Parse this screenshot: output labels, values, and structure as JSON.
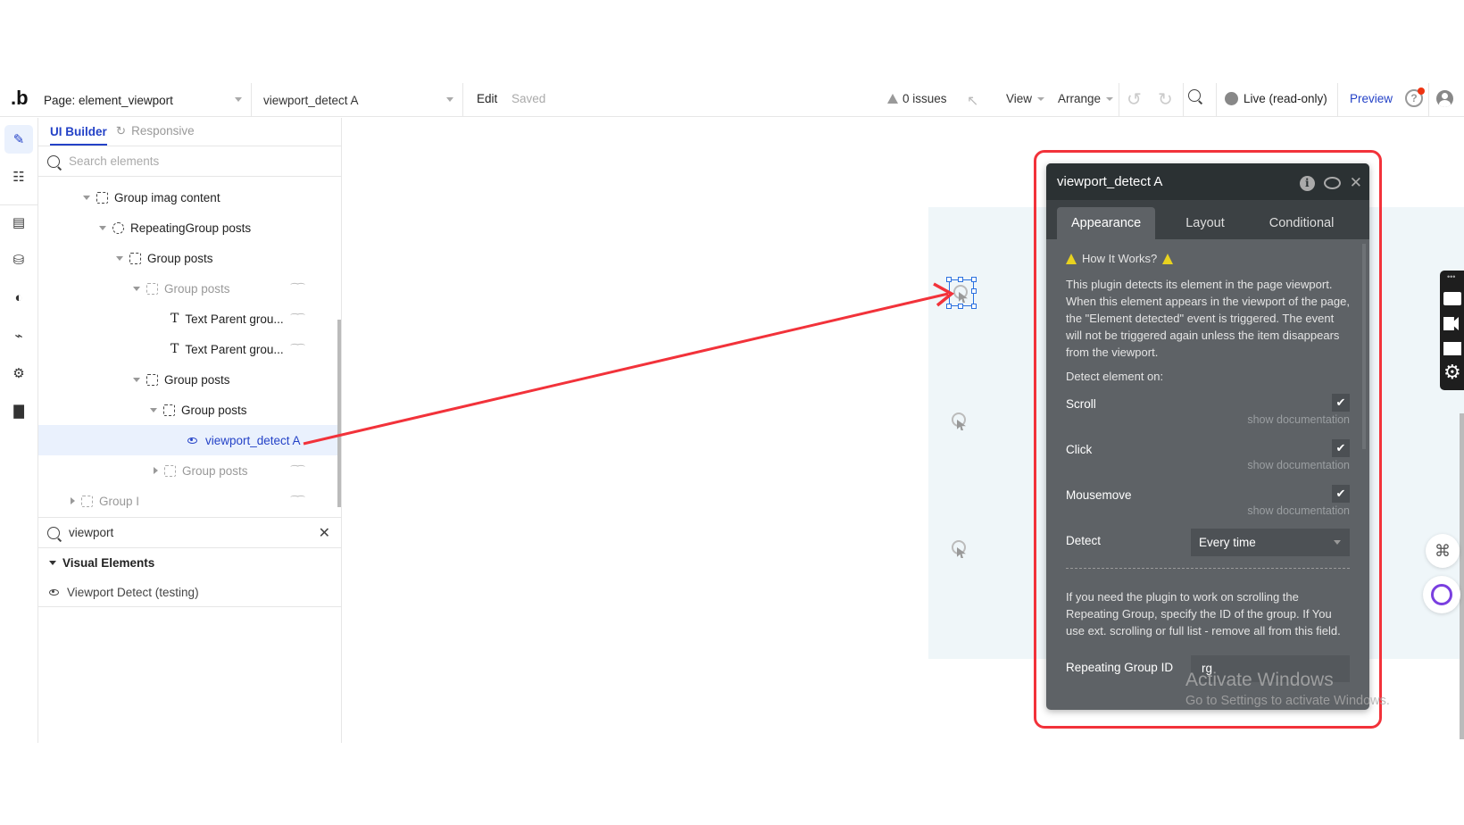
{
  "topbar": {
    "logo": ".b",
    "page_label": "Page: element_viewport",
    "element_label": "viewport_detect A",
    "edit": "Edit",
    "saved": "Saved",
    "issues": "0 issues",
    "view": "View",
    "arrange": "Arrange",
    "live": "Live (read-only)",
    "preview": "Preview"
  },
  "leftrail": {
    "items": [
      "design",
      "workflow",
      "data-types",
      "database",
      "styles",
      "plugins",
      "settings",
      "logs"
    ]
  },
  "panel": {
    "tabs": {
      "ui_builder": "UI Builder",
      "responsive": "Responsive"
    },
    "search_placeholder": "Search elements",
    "tree": [
      {
        "label": "Group imag content",
        "type": "group",
        "expanded": true,
        "hidden": false
      },
      {
        "label": "RepeatingGroup posts",
        "type": "repeating-group",
        "expanded": true,
        "hidden": false
      },
      {
        "label": "Group posts",
        "type": "group",
        "expanded": true,
        "hidden": false
      },
      {
        "label": "Group posts",
        "type": "group",
        "expanded": true,
        "hidden": true
      },
      {
        "label": "Text Parent grou...",
        "type": "text",
        "hidden": true
      },
      {
        "label": "Text Parent grou...",
        "type": "text",
        "hidden": true
      },
      {
        "label": "Group posts",
        "type": "group",
        "expanded": true,
        "hidden": false
      },
      {
        "label": "Group posts",
        "type": "group",
        "expanded": true,
        "hidden": false
      },
      {
        "label": "viewport_detect A",
        "type": "plugin",
        "selected": true
      },
      {
        "label": "Group posts",
        "type": "group",
        "expanded": false,
        "hidden": true
      },
      {
        "label": "Group I",
        "type": "group",
        "expanded": false,
        "hidden": true
      }
    ],
    "filter_value": "viewport",
    "category": "Visual Elements",
    "result": "Viewport Detect (testing)"
  },
  "editor": {
    "title": "viewport_detect A",
    "tabs": [
      "Appearance",
      "Layout",
      "Conditional"
    ],
    "active_tab": "Appearance",
    "how_title": "How It Works?",
    "description": "This plugin detects its element in the page viewport. When this element appears in the viewport of the page, the \"Element detected\" event is triggered. The event will not be triggered again unless the item disappears from the viewport.",
    "detect_on": "Detect element on:",
    "options": [
      {
        "label": "Scroll",
        "checked": true,
        "doc": "show documentation"
      },
      {
        "label": "Click",
        "checked": true,
        "doc": "show documentation"
      },
      {
        "label": "Mousemove",
        "checked": true,
        "doc": "show documentation"
      }
    ],
    "detect_label": "Detect",
    "detect_value": "Every time",
    "rg_description": "If you need the plugin to work on scrolling the Repeating Group, specify the ID of the group. If You use ext. scrolling or full list - remove all from this field.",
    "rg_label": "Repeating Group ID",
    "rg_value": "rg"
  },
  "watermark": {
    "line1": "Activate Windows",
    "line2": "Go to Settings to activate Windows."
  },
  "colors": {
    "accent": "#2442c7",
    "annotation": "#f2323a",
    "editor_bg": "#5e6266",
    "editor_header": "#2b3133"
  }
}
